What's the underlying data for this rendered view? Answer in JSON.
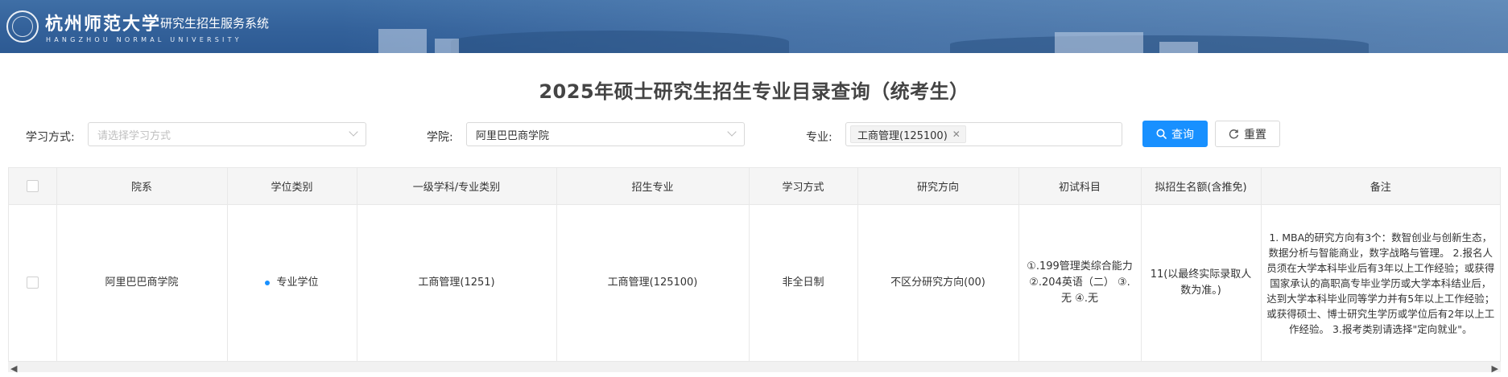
{
  "header": {
    "university_name": "杭州师范大学",
    "system_name": "研究生招生服务系统",
    "university_name_en": "HANGZHOU NORMAL UNIVERSITY"
  },
  "page_title": "2025年硕士研究生招生专业目录查询（统考生）",
  "filters": {
    "study_mode": {
      "label": "学习方式:",
      "placeholder": "请选择学习方式",
      "value": ""
    },
    "college": {
      "label": "学院:",
      "value": "阿里巴巴商学院"
    },
    "major": {
      "label": "专业:",
      "tag": "工商管理(125100)"
    }
  },
  "buttons": {
    "search": "查询",
    "reset": "重置"
  },
  "table": {
    "headers": [
      "院系",
      "学位类别",
      "一级学科/专业类别",
      "招生专业",
      "学习方式",
      "研究方向",
      "初试科目",
      "拟招生名额(含推免)",
      "备注"
    ],
    "rows": [
      {
        "department": "阿里巴巴商学院",
        "degree_type": "专业学位",
        "discipline": "工商管理(1251)",
        "major": "工商管理(125100)",
        "study_mode": "非全日制",
        "direction": "不区分研究方向(00)",
        "exam_subjects": "①.199管理类综合能力 ②.204英语（二） ③.无 ④.无",
        "quota": "11(以最终实际录取人数为准。)",
        "remarks": "1. MBA的研究方向有3个：数智创业与创新生态，数据分析与智能商业，数字战略与管理。 2.报名人员须在大学本科毕业后有3年以上工作经验；或获得国家承认的高职高专毕业学历或大学本科结业后，达到大学本科毕业同等学力并有5年以上工作经验；或获得硕士、博士研究生学历或学位后有2年以上工作经验。 3.报考类别请选择\"定向就业\"。"
      }
    ]
  },
  "icons": {
    "search": "search-icon",
    "reset": "refresh-icon",
    "dropdown": "chevron-down-icon",
    "close": "close-icon"
  },
  "colors": {
    "primary": "#1890ff",
    "banner": "#33619a"
  }
}
